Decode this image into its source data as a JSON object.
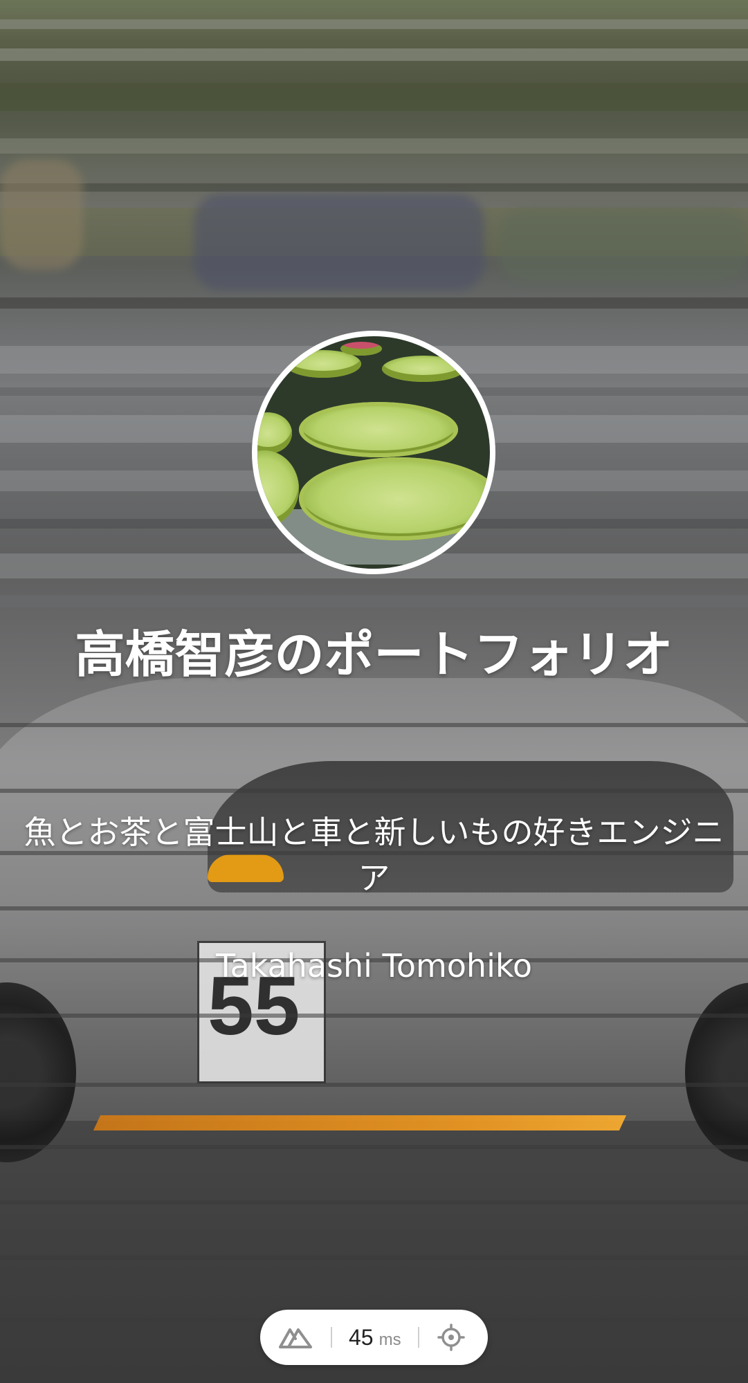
{
  "hero": {
    "title": "高橋智彦のポートフォリオ",
    "subtitle": "魚とお茶と富士山と車と新しいもの好きエンジニア",
    "name": "Takahashi Tomohiko"
  },
  "perf_widget": {
    "logo_icon": "nuxt-mountain-icon",
    "value": "45",
    "unit": "ms",
    "action_icon": "crosshair-target-icon"
  },
  "colors": {
    "text": "#ffffff",
    "pill_bg": "#ffffff",
    "pill_text": "#222222",
    "pill_muted": "#8a8a8a"
  }
}
